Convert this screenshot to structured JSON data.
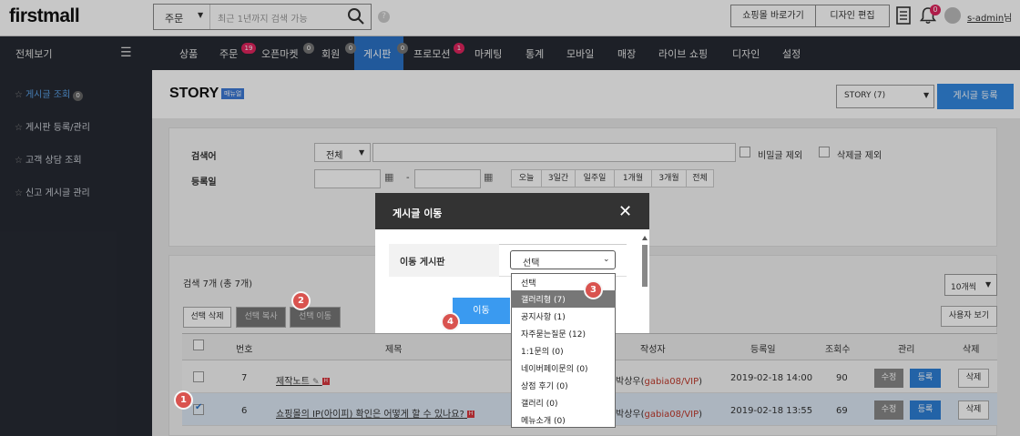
{
  "header": {
    "logo": "firstmall",
    "search_select": "주문",
    "search_placeholder": "최근 1년까지 검색 가능",
    "help": "?",
    "goto_mall": "쇼핑몰 바로가기",
    "design_edit": "디자인 편집",
    "bell_count": "0",
    "username": "s-admin",
    "username_suffix": "님"
  },
  "nav": {
    "all_view": "전체보기",
    "items": [
      {
        "label": "상품"
      },
      {
        "label": "주문",
        "badge": "19"
      },
      {
        "label": "오픈마켓",
        "badge": "0"
      },
      {
        "label": "회원",
        "badge": "0"
      },
      {
        "label": "게시판",
        "badge": "0"
      },
      {
        "label": "프로모션",
        "badge": "1"
      },
      {
        "label": "마케팅"
      },
      {
        "label": "통계"
      },
      {
        "label": "모바일"
      },
      {
        "label": "매장"
      },
      {
        "label": "라이브 쇼핑"
      },
      {
        "label": "디자인"
      },
      {
        "label": "설정"
      }
    ]
  },
  "sidebar": {
    "items": [
      {
        "label": "게시글 조회",
        "badge": "0"
      },
      {
        "label": "게시판 등록/관리"
      },
      {
        "label": "고객 상담 조회"
      },
      {
        "label": "신고 게시글 관리"
      }
    ]
  },
  "page": {
    "title": "STORY",
    "manual": "매뉴얼",
    "board_select": "STORY (7)",
    "write_button": "게시글 등록"
  },
  "filter": {
    "keyword_label": "검색어",
    "keyword_select": "전체",
    "exclude_secret": "비밀글 제외",
    "exclude_deleted": "삭제글 제외",
    "date_label": "등록일",
    "dash": "-",
    "date_buttons": [
      "오늘",
      "3일간",
      "일주일",
      "1개월",
      "3개월",
      "전체"
    ]
  },
  "list": {
    "count": "검색 7개 (총 7개)",
    "delete_selected": "선택 삭제",
    "copy_selected": "선택 복사",
    "move_selected": "선택 이동",
    "per_page": "10개씩",
    "user_view": "사용자 보기",
    "columns": {
      "no": "번호",
      "title": "제목",
      "author": "작성자",
      "date": "등록일",
      "views": "조회수",
      "manage": "관리",
      "delete": "삭제"
    },
    "modify_label": "수정",
    "register_label": "등록",
    "delete_label": "삭제",
    "rows": [
      {
        "no": "7",
        "title": "제작노트",
        "author_name": "박상우",
        "author_id": "gabia08/VIP",
        "date": "2019-02-18 14:00",
        "views": "90",
        "checked": false
      },
      {
        "no": "6",
        "title": "쇼핑몰의 IP(아이피) 확인은 어떻게 할 수 있나요?",
        "author_name": "박상우",
        "author_id": "gabia08/VIP",
        "date": "2019-02-18 13:55",
        "views": "69",
        "checked": true
      }
    ]
  },
  "modal": {
    "title": "게시글 이동",
    "label": "이동 게시판",
    "selected": "선택",
    "move_button": "이동",
    "options": [
      "선택",
      "갤러리형 (7)",
      "공지사항 (1)",
      "자주묻는질문 (12)",
      "1:1문의 (0)",
      "네이버페이문의 (0)",
      "상점 후기 (0)",
      "갤러리 (0)",
      "메뉴소개 (0)"
    ],
    "highlighted_index": 1
  },
  "steps": [
    "1",
    "2",
    "3",
    "4"
  ],
  "colors": {
    "accent": "#2b73c7",
    "step": "#d9534f",
    "nav_bg": "#262a33"
  }
}
